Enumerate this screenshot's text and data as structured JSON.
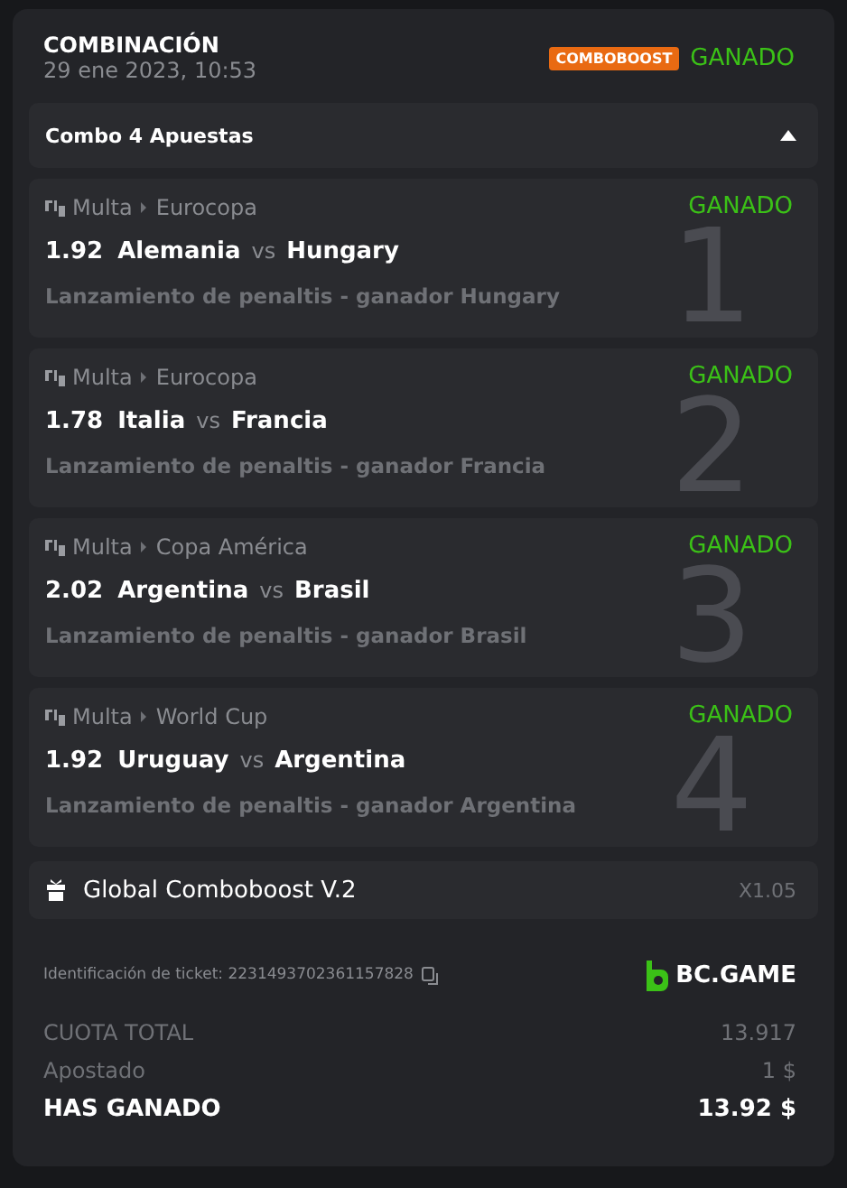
{
  "header": {
    "title": "COMBINACIÓN",
    "date": "29 ene 2023, 10:53",
    "badge": "COMBOBOOST",
    "status": "GANADO"
  },
  "combo": {
    "label": "Combo 4 Apuestas",
    "expanded": true
  },
  "bets": [
    {
      "sport": "Multa",
      "league": "Eurocopa",
      "status": "GANADO",
      "odds": "1.92",
      "home": "Alemania",
      "vs": "vs",
      "away": "Hungary",
      "market": "Lanzamiento de penaltis - ganador Hungary",
      "index": "1"
    },
    {
      "sport": "Multa",
      "league": "Eurocopa",
      "status": "GANADO",
      "odds": "1.78",
      "home": "Italia",
      "vs": "vs",
      "away": "Francia",
      "market": "Lanzamiento de penaltis - ganador Francia",
      "index": "2"
    },
    {
      "sport": "Multa",
      "league": "Copa América",
      "status": "GANADO",
      "odds": "2.02",
      "home": "Argentina",
      "vs": "vs",
      "away": "Brasil",
      "market": "Lanzamiento de penaltis - ganador Brasil",
      "index": "3"
    },
    {
      "sport": "Multa",
      "league": "World Cup",
      "status": "GANADO",
      "odds": "1.92",
      "home": "Uruguay",
      "vs": "vs",
      "away": "Argentina",
      "market": "Lanzamiento de penaltis - ganador Argentina",
      "index": "4"
    }
  ],
  "boost": {
    "label": "Global Comboboost V.2",
    "multiplier": "X1.05"
  },
  "ticket": {
    "label": "Identificación de ticket: 2231493702361157828",
    "brand": "BC.GAME"
  },
  "totals": [
    {
      "label": "CUOTA TOTAL",
      "value": "13.917",
      "kind": "muted"
    },
    {
      "label": "Apostado",
      "value": "1 $",
      "kind": "muted"
    },
    {
      "label": "HAS GANADO",
      "value": "13.92 $",
      "kind": "strong"
    }
  ]
}
